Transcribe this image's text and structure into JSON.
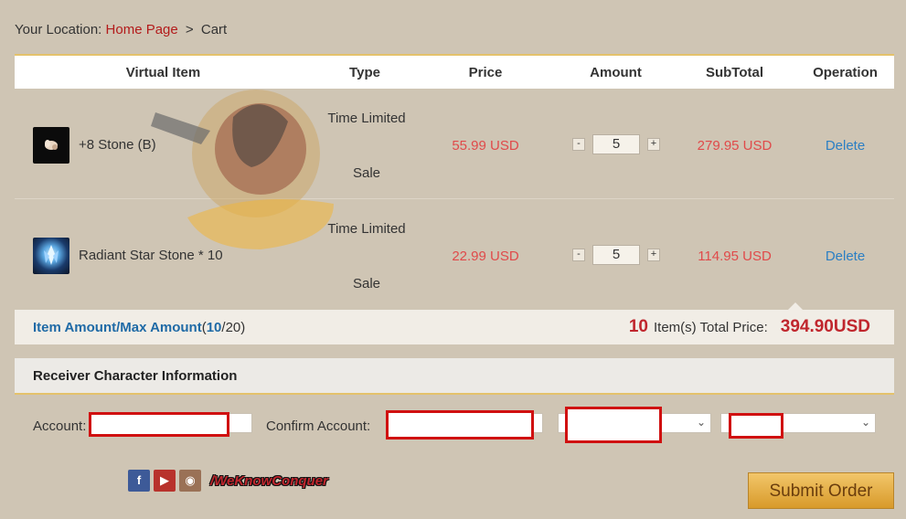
{
  "breadcrumb": {
    "prefix": "Your Location:",
    "home": "Home Page",
    "separator": ">",
    "current": "Cart"
  },
  "table": {
    "headers": [
      "Virtual Item",
      "Type",
      "Price",
      "Amount",
      "SubTotal",
      "Operation"
    ],
    "rows": [
      {
        "name": "+8 Stone (B)",
        "type_line1": "Time Limited",
        "type_line2": "Sale",
        "price": "55.99 USD",
        "amount": "5",
        "subtotal": "279.95 USD",
        "operation": "Delete"
      },
      {
        "name": "Radiant Star Stone * 10",
        "type_line1": "Time Limited",
        "type_line2": "Sale",
        "price": "22.99 USD",
        "amount": "5",
        "subtotal": "114.95 USD",
        "operation": "Delete"
      }
    ],
    "minus": "-",
    "plus": "+"
  },
  "summary": {
    "amount_label": "Item Amount/Max Amount",
    "current": "10",
    "max_part": "/20)",
    "count": "10",
    "items_label": "Item(s) Total Price:",
    "total": "394.90USD"
  },
  "receiver": {
    "title": "Receiver Character Information",
    "account_label": "Account:",
    "confirm_label": "Confirm Account:"
  },
  "footer": {
    "brand": "/WeKnowConquer",
    "submit": "Submit Order"
  },
  "colors": {
    "background": "#cfc5b4",
    "accent_gold": "#e4c26b",
    "price_red": "#e04a4a",
    "link_blue": "#2b7fc4",
    "redact_red": "#d01010"
  },
  "icons": [
    "facebook-icon",
    "youtube-icon",
    "instagram-icon",
    "chevron-down-icon"
  ]
}
